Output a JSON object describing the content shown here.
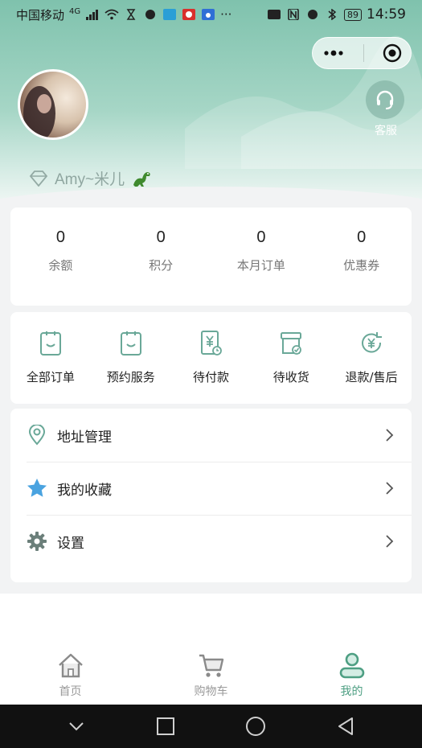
{
  "status_bar": {
    "carrier": "中国移动",
    "network": "4G",
    "more": "···",
    "battery": "89",
    "time": "14:59"
  },
  "header": {
    "customer_service_label": "客服",
    "nickname": "Amy~米儿"
  },
  "stats": [
    {
      "value": "0",
      "label": "余额"
    },
    {
      "value": "0",
      "label": "积分"
    },
    {
      "value": "0",
      "label": "本月订单"
    },
    {
      "value": "0",
      "label": "优惠券"
    }
  ],
  "orders": [
    {
      "label": "全部订单",
      "icon": "order-list-icon"
    },
    {
      "label": "预约服务",
      "icon": "appointment-icon"
    },
    {
      "label": "待付款",
      "icon": "payment-pending-icon"
    },
    {
      "label": "待收货",
      "icon": "delivery-pending-icon"
    },
    {
      "label": "退款/售后",
      "icon": "refund-icon"
    }
  ],
  "menu": [
    {
      "label": "地址管理",
      "icon": "location-pin-icon"
    },
    {
      "label": "我的收藏",
      "icon": "star-icon"
    },
    {
      "label": "设置",
      "icon": "gear-icon"
    }
  ],
  "tabbar": [
    {
      "label": "首页",
      "icon": "home-icon",
      "active": false
    },
    {
      "label": "购物车",
      "icon": "cart-icon",
      "active": false
    },
    {
      "label": "我的",
      "icon": "profile-icon",
      "active": true
    }
  ],
  "colors": {
    "accent": "#4e9f83",
    "header_top": "#7fc2ad",
    "icon_teal": "#6aa898",
    "star_blue": "#4aa3e0"
  }
}
